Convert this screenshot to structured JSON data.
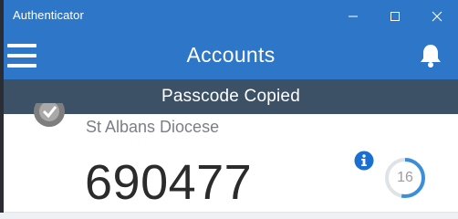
{
  "window": {
    "title": "Authenticator",
    "controls": {
      "minimize": "minimize",
      "maximize": "maximize",
      "close": "close"
    }
  },
  "appbar": {
    "title": "Accounts",
    "menu_icon": "hamburger-menu-icon",
    "notifications_icon": "bell-icon"
  },
  "toast": {
    "message": "Passcode Copied"
  },
  "accounts": [
    {
      "name": "St Albans Diocese",
      "code": "690477",
      "seconds_remaining": "16",
      "timer_fraction": 0.53,
      "info_icon": "info-icon",
      "logo_icon": "account-logo-icon"
    }
  ],
  "colors": {
    "accent": "#2e77c8",
    "toast_bg": "#3d5166",
    "info_blue": "#1a6fd1",
    "timer_blue": "#3a8fd8"
  }
}
